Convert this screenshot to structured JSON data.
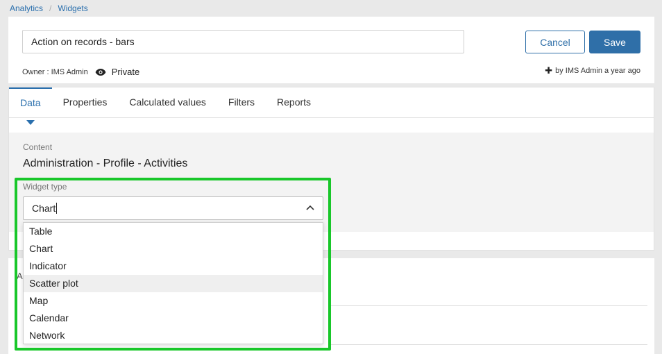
{
  "breadcrumb": {
    "items": [
      "Analytics",
      "Widgets"
    ],
    "separator": "/"
  },
  "header": {
    "title_value": "Action on records - bars",
    "cancel_label": "Cancel",
    "save_label": "Save",
    "owner_label": "Owner : IMS Admin",
    "privacy": "Private",
    "created_by": "by IMS Admin a year ago"
  },
  "tabs": [
    {
      "label": "Data",
      "active": true
    },
    {
      "label": "Properties"
    },
    {
      "label": "Calculated values"
    },
    {
      "label": "Filters"
    },
    {
      "label": "Reports"
    }
  ],
  "content": {
    "label": "Content",
    "value": "Administration - Profile - Activities"
  },
  "widget_type": {
    "label": "Widget type",
    "value": "Chart",
    "options": [
      "Table",
      "Chart",
      "Indicator",
      "Scatter plot",
      "Map",
      "Calendar",
      "Network"
    ],
    "hovered_option": "Scatter plot"
  },
  "colors": {
    "accent": "#2f6fa8",
    "highlight": "#19c72a"
  },
  "icons": {
    "privacy": "eye-icon",
    "created": "plus-icon",
    "select": "chevron-up-icon"
  }
}
